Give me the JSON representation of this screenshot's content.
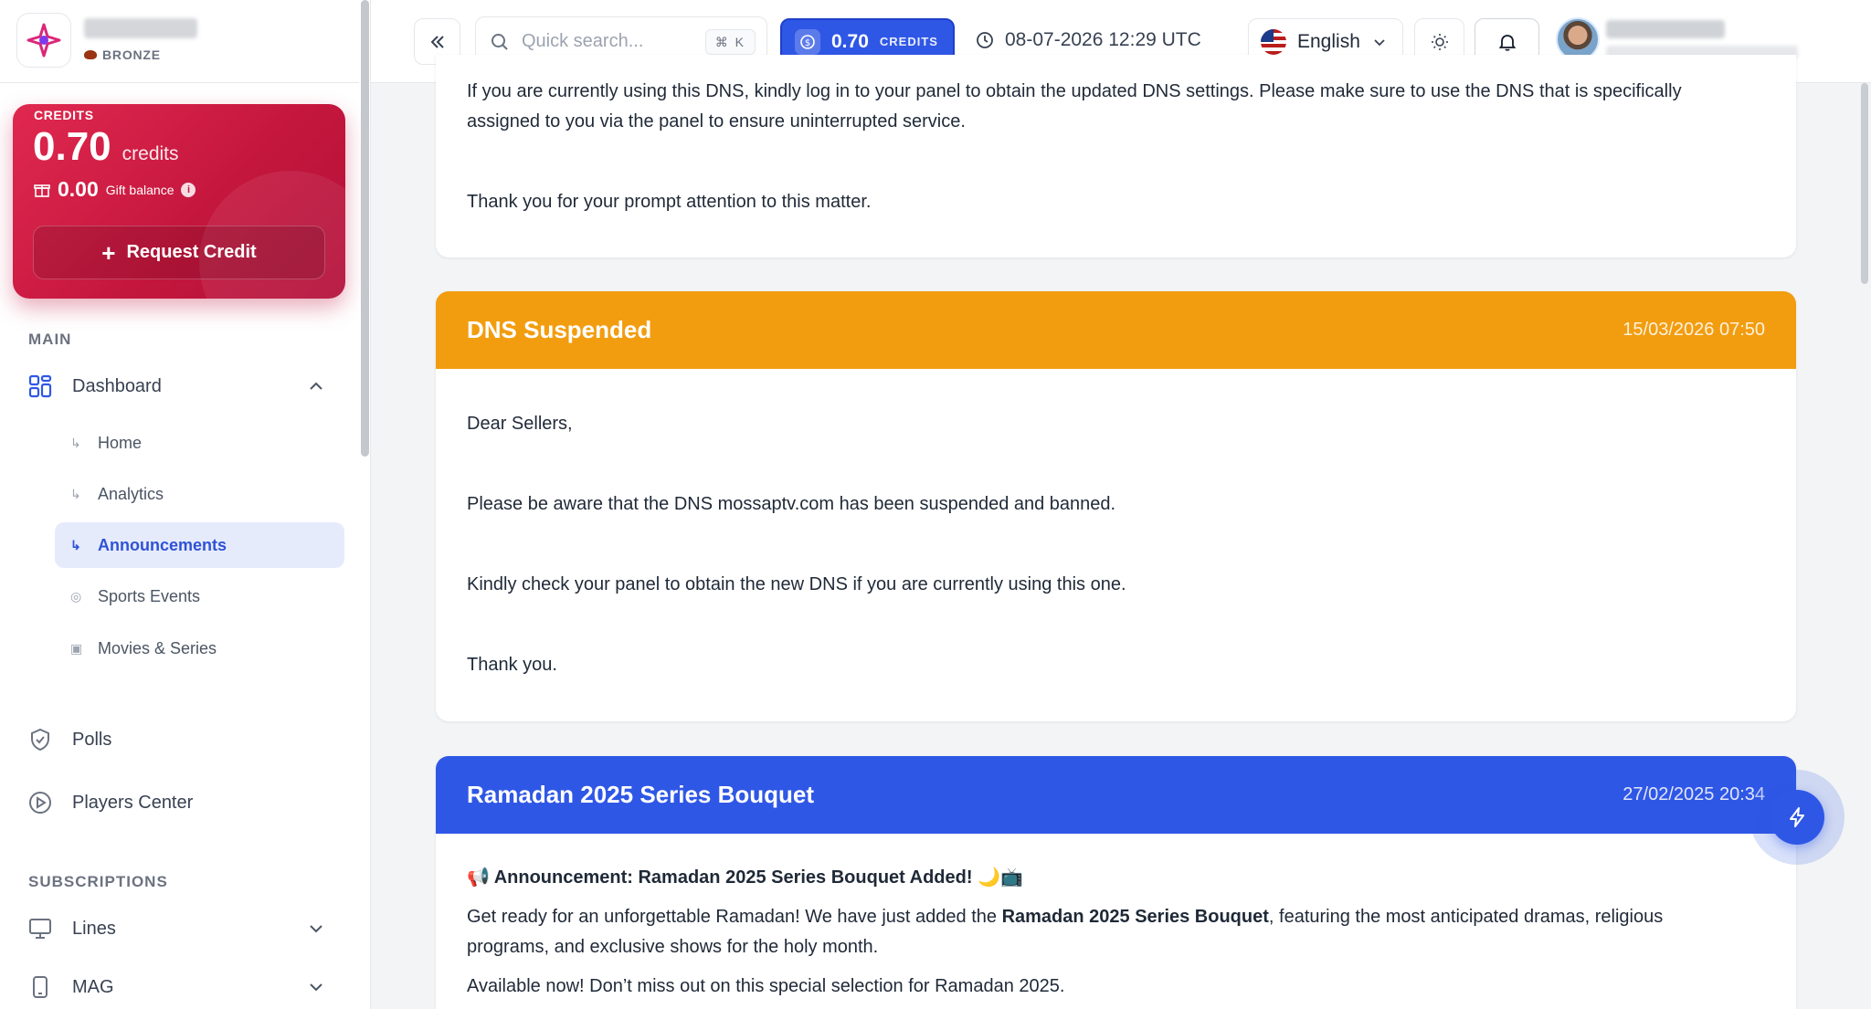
{
  "brand": {
    "tier": "BRONZE"
  },
  "credit_card": {
    "label": "CREDITS",
    "amount": "0.70",
    "unit": "credits",
    "gift_amount": "0.00",
    "gift_label": "Gift balance",
    "request_button": "Request Credit"
  },
  "sidebar": {
    "main_label": "MAIN",
    "dashboard": "Dashboard",
    "sub_items": [
      "Home",
      "Analytics",
      "Announcements",
      "Sports Events",
      "Movies & Series"
    ],
    "polls": "Polls",
    "players_center": "Players Center",
    "subscriptions_label": "SUBSCRIPTIONS",
    "lines": "Lines",
    "mag": "MAG"
  },
  "header": {
    "search_placeholder": "Quick search...",
    "shortcut": "⌘ K",
    "credits_value": "0.70",
    "credits_label": "CREDITS",
    "datetime": "08-07-2026 12:29 UTC",
    "language": "English"
  },
  "announcements": {
    "top_partial": {
      "line1": "If you are currently using this DNS, kindly log in to your panel to obtain the updated DNS settings. Please make sure to use the DNS that is specifically",
      "line2": "assigned to you via the panel to ensure uninterrupted service.",
      "line3": "Thank you for your prompt attention to this matter."
    },
    "dns_suspended": {
      "title": "DNS Suspended",
      "date": "15/03/2026 07:50",
      "color": "#f29d0f",
      "p1": "Dear Sellers,",
      "p2": "Please be aware that the DNS mossaptv.com has been suspended and banned.",
      "p3": "Kindly check your panel to obtain the new DNS if you are currently using this one.",
      "p4": "Thank you."
    },
    "ramadan": {
      "title": "Ramadan 2025 Series Bouquet",
      "date": "27/02/2025 20:34",
      "color": "#2f57e6",
      "headline": "📢 Announcement: Ramadan 2025 Series Bouquet Added! 🌙📺",
      "body_pre": "Get ready for an unforgettable Ramadan! We have just added the ",
      "body_bold": "Ramadan 2025 Series Bouquet",
      "body_post": ", featuring the most anticipated dramas, religious",
      "body_line2": "programs, and exclusive shows for the holy month.",
      "body_line3": "Available now! Don’t miss out on this special selection for Ramadan 2025."
    }
  }
}
